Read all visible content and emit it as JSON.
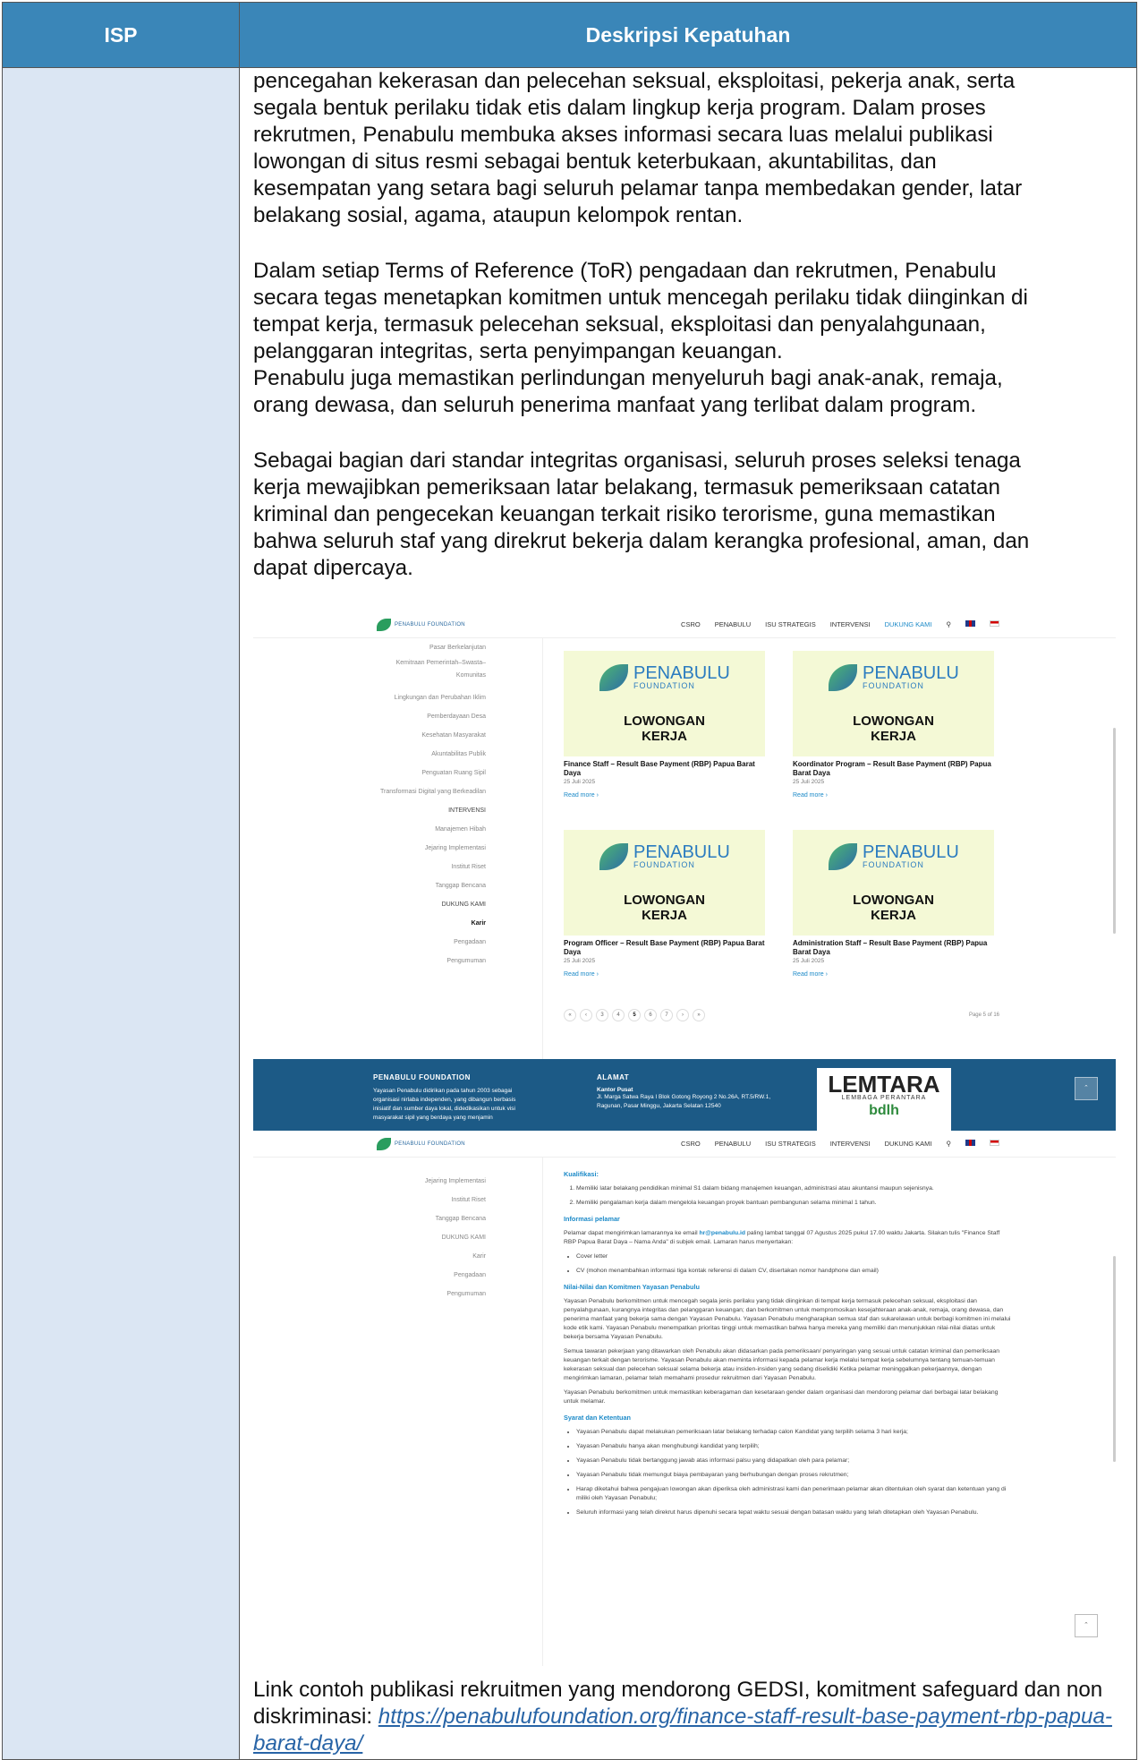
{
  "header": {
    "isp": "ISP",
    "desc": "Deskripsi Kepatuhan"
  },
  "para1": [
    "pencegahan kekerasan dan pelecehan seksual, eksploitasi, pekerja anak, serta",
    "segala bentuk perilaku tidak etis dalam lingkup kerja program. Dalam proses",
    "rekrutmen, Penabulu membuka akses informasi secara luas melalui publikasi",
    "lowongan di situs resmi sebagai bentuk keterbukaan, akuntabilitas, dan",
    "kesempatan yang setara bagi seluruh pelamar tanpa membedakan gender, latar",
    "belakang sosial, agama, ataupun kelompok rentan."
  ],
  "para2": [
    "Dalam setiap Terms of Reference (ToR) pengadaan dan rekrutmen, Penabulu",
    "secara tegas menetapkan komitmen untuk mencegah perilaku tidak diinginkan di",
    "tempat kerja, termasuk pelecehan seksual, eksploitasi dan penyalahgunaan,",
    "pelanggaran integritas, serta penyimpangan keuangan.",
    "Penabulu juga memastikan perlindungan menyeluruh bagi anak-anak, remaja,",
    "orang dewasa, dan seluruh penerima manfaat yang terlibat dalam program."
  ],
  "para3": [
    "Sebagai bagian dari standar integritas organisasi, seluruh proses seleksi tenaga",
    "kerja mewajibkan pemeriksaan latar belakang, termasuk pemeriksaan catatan",
    "kriminal dan pengecekan keuangan terkait risiko terorisme, guna memastikan",
    "bahwa seluruh staf yang direkrut bekerja dalam kerangka profesional, aman, dan",
    "dapat dipercaya."
  ],
  "nav": {
    "logo": "PENABULU FOUNDATION",
    "links": [
      "CSRO",
      "PENABULU",
      "ISU STRATEGIS",
      "INTERVENSI",
      "DUKUNG KAMI"
    ]
  },
  "side1": [
    "Pasar Berkelanjutan",
    "Kemitraan Pemerintah–Swasta–",
    "Komunitas",
    "Lingkungan dan Perubahan Iklim",
    "Pemberdayaan Desa",
    "Kesehatan Masyarakat",
    "Akuntabilitas Publik",
    "Penguatan Ruang Sipil",
    "Transformasi Digital yang Berkeadilan",
    "INTERVENSI",
    "Manajemen Hibah",
    "Jejaring Implementasi",
    "Institut Riset",
    "Tanggap Bencana",
    "DUKUNG KAMI",
    "Karir",
    "Pengadaan",
    "Pengumuman"
  ],
  "cards": [
    {
      "title": "Finance Staff – Result Base Payment (RBP) Papua Barat Daya",
      "date": "25 Juli 2025"
    },
    {
      "title": "Koordinator Program – Result Base Payment (RBP) Papua Barat Daya",
      "date": "25 Juli 2025"
    },
    {
      "title": "Program Officer – Result Base Payment (RBP) Papua Barat Daya",
      "date": "25 Juli 2025"
    },
    {
      "title": "Administration Staff – Result Base Payment (RBP) Papua Barat Daya",
      "date": "25 Juli 2025"
    }
  ],
  "card_brand": "PENABULU",
  "card_brand_sub": "FOUNDATION",
  "card_lk1": "LOWONGAN",
  "card_lk2": "KERJA",
  "read_more": "Read more ›",
  "pager": [
    "«",
    "‹",
    "3",
    "4",
    "5",
    "6",
    "7",
    "›",
    "»"
  ],
  "page_info": "Page 5 of 16",
  "footer": {
    "org": "PENABULU FOUNDATION",
    "org_text": "Yayasan Penabulu didirikan pada tahun 2003 sebagai organisasi nirlaba independen, yang dibangun berbasis inisiatif dan sumber daya lokal, didedikasikan untuk visi masyarakat sipil yang berdaya yang menjamin",
    "addr_title": "ALAMAT",
    "addr_sub": "Kantor Pusat",
    "addr": "Jl. Marga Satwa Raya I Blok Gotong Royong 2 No.26A, RT.5/RW.1, Ragunan, Pasar Minggu, Jakarta Selatan 12540",
    "lem1": "LEMTARA",
    "lem2": "LEMBAGA PERANTARA",
    "lem3": "bdlh"
  },
  "side2": [
    "Jejaring Implementasi",
    "Institut Riset",
    "Tanggap Bencana",
    "DUKUNG KAMI",
    "Karir",
    "Pengadaan",
    "Pengumuman"
  ],
  "article": {
    "h_kual": "Kualifikasi:",
    "kual": [
      "Memiliki latar belakang pendidikan minimal S1 dalam bidang manajemen keuangan, administrasi atau akuntansi maupun sejenisnya.",
      "Memiliki pengalaman kerja dalam mengelola keuangan proyek bantuan pembangunan selama minimal 1 tahun."
    ],
    "h_info": "Informasi pelamar",
    "info_pre": "Pelamar dapat mengirimkan lamarannya ke email ",
    "info_mail": "hr@penabulu.id",
    "info_post": " paling lambat tanggal 07 Agustus 2025 pukul 17.00 waktu Jakarta. Silakan tulis \"Finance Staff RBP Papua Barat Daya – Nama Anda\" di subjek email. Lamaran harus menyertakan:",
    "info_list": [
      "Cover letter",
      "CV (mohon menambahkan informasi tiga kontak referensi di dalam CV, disertakan nomor handphone dan email)"
    ],
    "h_nilai": "Nilai-Nilai dan Komitmen Yayasan Penabulu",
    "nilai1": "Yayasan Penabulu berkomitmen untuk mencegah segala jenis perilaku yang tidak diinginkan di tempat kerja termasuk pelecehan seksual, eksploitasi dan penyalahgunaan, kurangnya integritas dan pelanggaran keuangan; dan berkomitmen untuk mempromosikan kesejahteraan anak-anak, remaja, orang dewasa, dan penerima manfaat yang bekerja sama dengan Yayasan Penabulu. Yayasan Penabulu mengharapkan semua staf dan sukarelawan untuk berbagi komitmen ini melalui kode etik kami. Yayasan Penabulu menempatkan prioritas tinggi untuk memastikan bahwa hanya mereka yang memiliki dan menunjukkan nilai-nilai diatas untuk bekerja bersama Yayasan Penabulu.",
    "nilai2": "Semua tawaran pekerjaan yang ditawarkan oleh Penabulu akan didasarkan pada pemeriksaan/ penyaringan yang sesuai untuk catatan kriminal dan pemeriksaan keuangan terkait dengan terorisme. Yayasan Penabulu akan meminta informasi kepada pelamar kerja melalui tempat kerja sebelumnya tentang temuan-temuan kekerasan seksual dan pelecehan seksual selama bekerja atau insiden-insiden yang sedang diselidiki Ketika pelamar meninggalkan pekerjaannya, dengan mengirimkan lamaran, pelamar telah memahami prosedur rekruitmen dari Yayasan Penabulu.",
    "nilai3": "Yayasan Penabulu berkomitmen untuk memastikan keberagaman dan kesetaraan gender dalam organisasi dan mendorong pelamar dari berbagai latar belakang untuk melamar.",
    "h_syarat": "Syarat dan Ketentuan",
    "syarat": [
      "Yayasan Penabulu dapat melakukan pemeriksaan latar belakang terhadap calon Kandidat yang terpilih selama 3 hari kerja;",
      "Yayasan Penabulu hanya akan menghubungi kandidat yang terpilih;",
      "Yayasan Penabulu tidak bertanggung jawab atas informasi palsu yang didapatkan oleh para pelamar;",
      "Yayasan Penabulu tidak memungut biaya pembayaran yang berhubungan dengan proses rekrutmen;",
      "Harap diketahui bahwa pengajuan lowongan akan diperiksa oleh administrasi kami dan penerimaan pelamar akan ditentukan oleh syarat dan ketentuan yang di miliki oleh Yayasan Penabulu;",
      "Seluruh informasi yang telah direkrut harus dipenuhi secara tepat waktu sesuai dengan batasan waktu yang telah ditetapkan oleh Yayasan Penabulu."
    ]
  },
  "link_text": "Link contoh publikasi rekruitmen yang mendorong GEDSI, komitment safeguard dan non diskriminasi: ",
  "link_url": "https://penabulufoundation.org/finance-staff-result-base-payment-rbp-papua-barat-daya/"
}
